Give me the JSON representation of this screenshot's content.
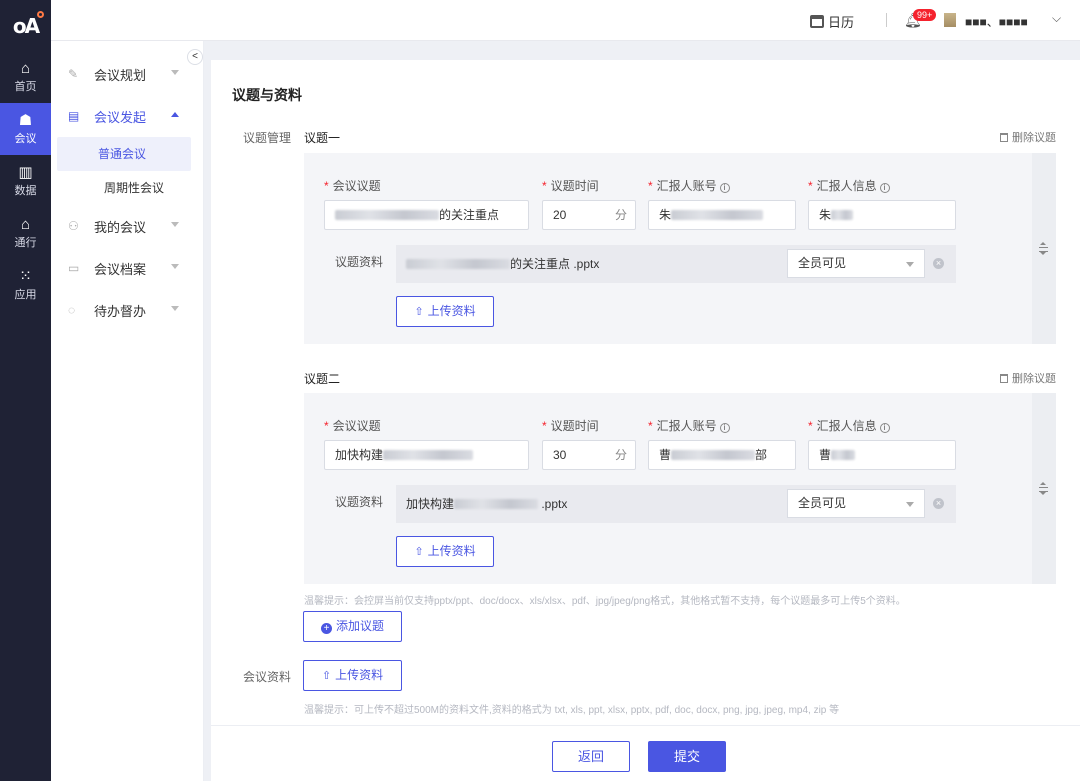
{
  "rail": {
    "items": [
      {
        "label": "首页",
        "icon": "home-icon"
      },
      {
        "label": "会议",
        "icon": "meeting-icon",
        "active": true
      },
      {
        "label": "数据",
        "icon": "data-chart-icon"
      },
      {
        "label": "通行",
        "icon": "access-icon"
      },
      {
        "label": "应用",
        "icon": "apps-grid-icon"
      }
    ]
  },
  "topbar": {
    "calendar_label": "日历",
    "badge": "99+",
    "user_name": "■■■、■■■■"
  },
  "sidebar": {
    "collapse_glyph": "<",
    "items": [
      {
        "label": "会议规划",
        "icon": "edit-icon"
      },
      {
        "label": "会议发起",
        "icon": "form-icon",
        "open": true
      },
      {
        "label": "我的会议",
        "icon": "people-icon"
      },
      {
        "label": "会议档案",
        "icon": "archive-icon"
      },
      {
        "label": "待办督办",
        "icon": "todo-icon"
      }
    ],
    "sub_items": [
      {
        "label": "普通会议",
        "active": true
      },
      {
        "label": "周期性会议"
      }
    ]
  },
  "main": {
    "section_title": "议题与资料",
    "topic_mgmt_label": "议题管理",
    "delete_label": "删除议题",
    "field_labels": {
      "topic": "会议议题",
      "time": "议题时间",
      "reporter_account": "汇报人账号",
      "reporter_info": "汇报人信息",
      "material": "议题资料"
    },
    "unit_minutes": "分",
    "upload_label": "上传资料",
    "visibility": "全员可见",
    "topics": [
      {
        "title": "议题一",
        "topic_value_suffix": "的关注重点",
        "time": "20",
        "account_prefix": "朱",
        "info_prefix": "朱",
        "file_suffix": "的关注重点 .pptx"
      },
      {
        "title": "议题二",
        "topic_value_prefix": "加快构建",
        "time": "30",
        "account_prefix": "曹",
        "account_suffix": "部",
        "info_prefix": "曹",
        "file_prefix": "加快构建",
        "file_suffix": " .pptx"
      }
    ],
    "hint_topic": "温馨提示：会控屏当前仅支持pptx/ppt、doc/docx、xls/xlsx、pdf、jpg/jpeg/png格式，其他格式暂不支持，每个议题最多可上传5个资料。",
    "add_topic_label": "添加议题",
    "meeting_material_label": "会议资料",
    "hint_material": "温馨提示：可上传不超过500M的资料文件,资料的格式为 txt, xls, ppt, xlsx, pptx, pdf, doc, docx, png, jpg, jpeg, mp4, zip 等"
  },
  "footer": {
    "back_label": "返回",
    "submit_label": "提交"
  },
  "colors": {
    "accent": "#4a56e2",
    "rail_bg": "#1f2235",
    "required": "#f5222d"
  }
}
